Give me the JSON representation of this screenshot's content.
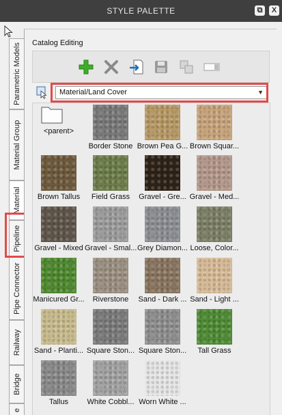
{
  "window": {
    "title": "STYLE PALETTE",
    "restore_glyph": "⧉",
    "close_glyph": "X"
  },
  "tabs": [
    {
      "label": "Parametric Models"
    },
    {
      "label": "Material Group"
    },
    {
      "label": "Material",
      "active": true
    },
    {
      "label": "Pipeline"
    },
    {
      "label": "Pipe Connector"
    },
    {
      "label": "Railway"
    },
    {
      "label": "Bridge"
    },
    {
      "label": "e"
    }
  ],
  "catalog": {
    "label": "Catalog Editing",
    "tools": [
      {
        "name": "add-icon",
        "color": "#3fae2a"
      },
      {
        "name": "delete-icon",
        "color": "#8a8a8a"
      },
      {
        "name": "import-icon",
        "color": "#1f6fbf"
      },
      {
        "name": "save-icon",
        "color": "#8a8a8a"
      },
      {
        "name": "copy-icon",
        "color": "#9a9a9a"
      },
      {
        "name": "rename-icon",
        "color": "#9a9a9a"
      }
    ]
  },
  "category": {
    "selected": "Material/Land Cover",
    "arrow": "▼"
  },
  "highlight_color": "#e24a4a",
  "materials": [
    {
      "label": "<parent>",
      "kind": "folder"
    },
    {
      "label": "Border Stone",
      "color": "#7a7a7a"
    },
    {
      "label": "Brown Pea G...",
      "color": "#b89a66"
    },
    {
      "label": "Brown Squar...",
      "color": "#c9a57c"
    },
    {
      "label": "Brown Tallus",
      "color": "#6e5a3c"
    },
    {
      "label": "Field Grass",
      "color": "#6d7d49"
    },
    {
      "label": "Gravel - Gre...",
      "color": "#2e2216"
    },
    {
      "label": "Gravel - Med...",
      "color": "#b5998c"
    },
    {
      "label": "Gravel - Mixed",
      "color": "#5f554a"
    },
    {
      "label": "Gravel - Smal...",
      "color": "#9d9d9d"
    },
    {
      "label": "Grey Diamon...",
      "color": "#8c8f94"
    },
    {
      "label": "Loose, Color...",
      "color": "#7d8066"
    },
    {
      "label": "Manicured Gr...",
      "color": "#4f8a2f"
    },
    {
      "label": "Riverstone",
      "color": "#9c9082"
    },
    {
      "label": "Sand - Dark ...",
      "color": "#8a7660"
    },
    {
      "label": "Sand - Light ...",
      "color": "#d8bc98"
    },
    {
      "label": "Sand - Planti...",
      "color": "#c9bc8d"
    },
    {
      "label": "Square Ston...",
      "color": "#7b7b7b"
    },
    {
      "label": "Square Ston...",
      "color": "#8f8f8f"
    },
    {
      "label": "Tall Grass",
      "color": "#4f8c35"
    },
    {
      "label": "Tallus",
      "color": "#8a8a8a"
    },
    {
      "label": "White Cobbl...",
      "color": "#a3a3a3"
    },
    {
      "label": "Worn White ...",
      "color": "#e6e6e6"
    }
  ]
}
